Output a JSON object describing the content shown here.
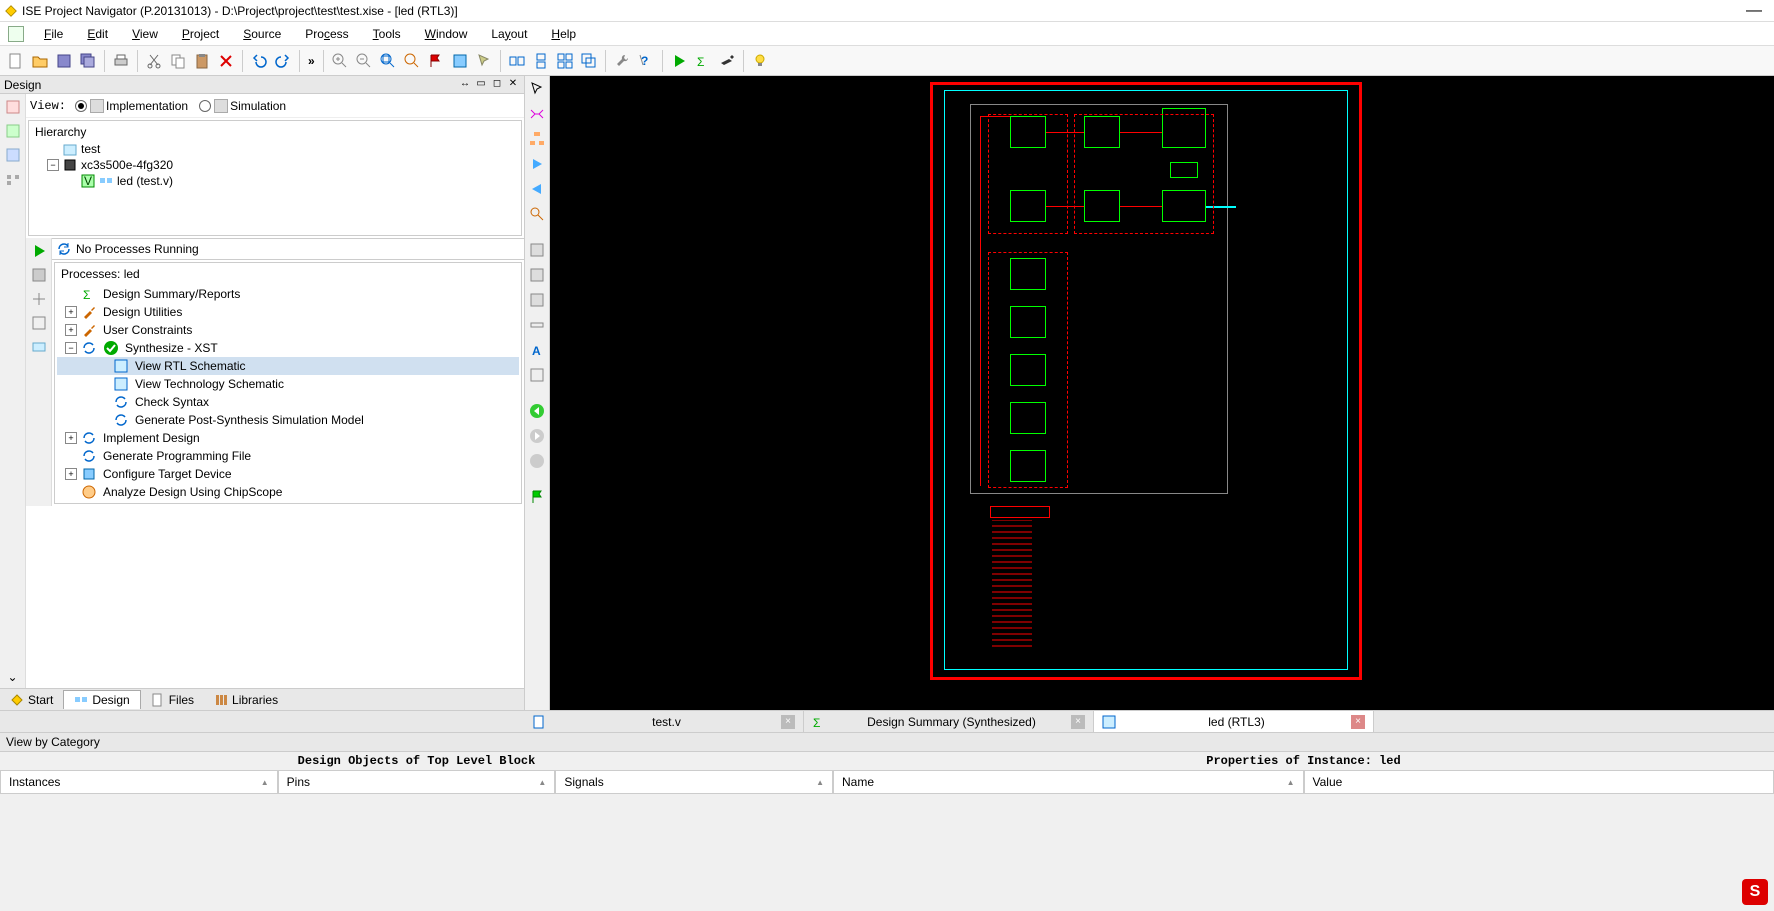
{
  "titlebar": {
    "text": "ISE Project Navigator (P.20131013) - D:\\Project\\project\\test\\test.xise - [led (RTL3)]"
  },
  "menubar": {
    "file": "File",
    "edit": "Edit",
    "view": "View",
    "project": "Project",
    "source": "Source",
    "process": "Process",
    "tools": "Tools",
    "window": "Window",
    "layout": "Layout",
    "help": "Help"
  },
  "design_panel": {
    "title": "Design",
    "view_label": "View:",
    "implementation": "Implementation",
    "simulation": "Simulation",
    "hierarchy_label": "Hierarchy",
    "tree": {
      "project": "test",
      "device": "xc3s500e-4fg320",
      "module": "led (test.v)"
    },
    "no_processes": "No Processes Running",
    "processes_title": "Processes: led",
    "items": {
      "design_summary": "Design Summary/Reports",
      "design_utilities": "Design Utilities",
      "user_constraints": "User Constraints",
      "synthesize": "Synthesize - XST",
      "view_rtl": "View RTL Schematic",
      "view_tech": "View Technology Schematic",
      "check_syntax": "Check Syntax",
      "gen_post": "Generate Post-Synthesis Simulation Model",
      "implement": "Implement Design",
      "gen_prog": "Generate Programming File",
      "configure": "Configure Target Device",
      "analyze": "Analyze Design Using ChipScope"
    }
  },
  "bottom_tabs": {
    "start": "Start",
    "design": "Design",
    "files": "Files",
    "libraries": "Libraries"
  },
  "doc_tabs": {
    "tab1": "test.v",
    "tab2": "Design Summary (Synthesized)",
    "tab3": "led (RTL3)"
  },
  "view_category": "View by Category",
  "bottom_table": {
    "left_title": "Design Objects of Top Level Block",
    "right_title": "Properties of Instance: led",
    "col_instances": "Instances",
    "col_pins": "Pins",
    "col_signals": "Signals",
    "col_name": "Name",
    "col_value": "Value"
  }
}
